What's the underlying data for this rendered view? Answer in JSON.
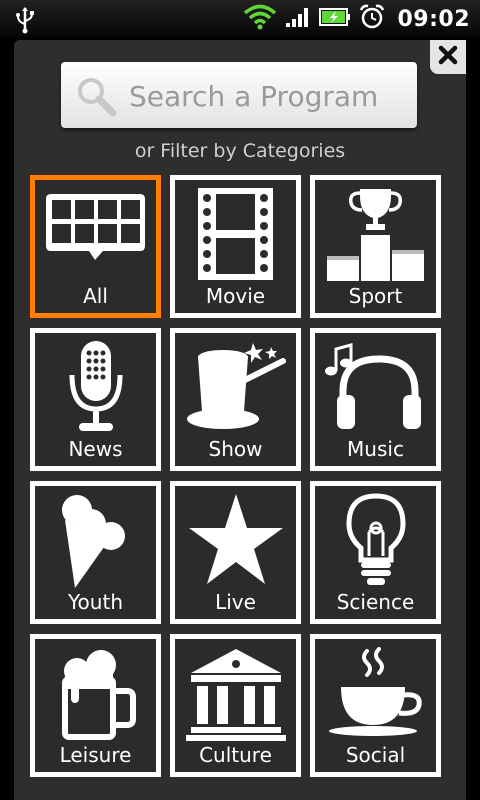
{
  "status": {
    "time": "09:02",
    "icons": [
      "usb-icon",
      "wifi-icon",
      "signal-icon",
      "battery-charging-icon",
      "alarm-icon"
    ]
  },
  "search": {
    "placeholder": "Search a Program"
  },
  "filter_label": "or Filter by Categories",
  "categories": [
    {
      "label": "All",
      "icon": "grid-bubble-icon",
      "selected": true
    },
    {
      "label": "Movie",
      "icon": "film-strip-icon",
      "selected": false
    },
    {
      "label": "Sport",
      "icon": "trophy-podium-icon",
      "selected": false
    },
    {
      "label": "News",
      "icon": "microphone-icon",
      "selected": false
    },
    {
      "label": "Show",
      "icon": "magic-hat-icon",
      "selected": false
    },
    {
      "label": "Music",
      "icon": "headphones-icon",
      "selected": false
    },
    {
      "label": "Youth",
      "icon": "ice-cream-icon",
      "selected": false
    },
    {
      "label": "Live",
      "icon": "star-icon",
      "selected": false
    },
    {
      "label": "Science",
      "icon": "light-bulb-icon",
      "selected": false
    },
    {
      "label": "Leisure",
      "icon": "beer-mug-icon",
      "selected": false
    },
    {
      "label": "Culture",
      "icon": "museum-icon",
      "selected": false
    },
    {
      "label": "Social",
      "icon": "coffee-cup-icon",
      "selected": false
    }
  ],
  "colors": {
    "accent": "#ff7f00",
    "panel": "#2e2e2e",
    "tile_border": "#ffffff"
  }
}
